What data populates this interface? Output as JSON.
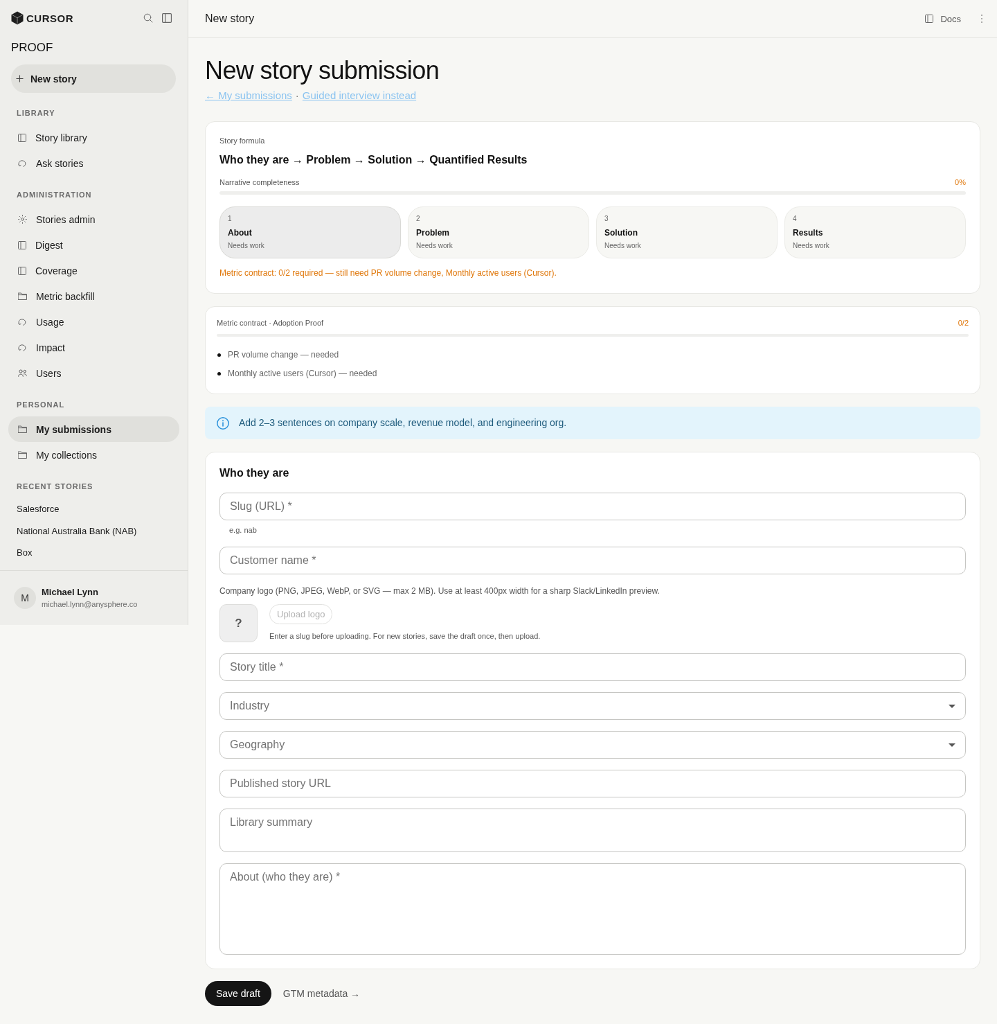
{
  "sidebar": {
    "brand": "CURSOR",
    "product": "PROOF",
    "new_button": {
      "label": "New story"
    },
    "sections": [
      {
        "title": "LIBRARY",
        "items": [
          {
            "label": "Story library",
            "kind": "panel",
            "selected": false
          },
          {
            "label": "Ask stories",
            "kind": "loop",
            "selected": false
          }
        ]
      },
      {
        "title": "ADMINISTRATION",
        "items": [
          {
            "label": "Stories admin",
            "kind": "sun",
            "selected": false
          },
          {
            "label": "Digest",
            "kind": "panel",
            "selected": false
          },
          {
            "label": "Coverage",
            "kind": "panel",
            "selected": false
          },
          {
            "label": "Metric backfill",
            "kind": "folder",
            "selected": false
          },
          {
            "label": "Usage",
            "kind": "loop",
            "selected": false
          },
          {
            "label": "Impact",
            "kind": "loop",
            "selected": false
          },
          {
            "label": "Users",
            "kind": "people",
            "selected": false
          }
        ]
      },
      {
        "title": "PERSONAL",
        "items": [
          {
            "label": "My submissions",
            "kind": "folder",
            "selected": true
          },
          {
            "label": "My collections",
            "kind": "folder",
            "selected": false
          }
        ]
      }
    ],
    "recent": {
      "title": "RECENT STORIES",
      "items": [
        "Salesforce",
        "National Australia Bank (NAB)",
        "Box"
      ]
    },
    "user": {
      "initial": "M",
      "name": "Michael Lynn",
      "email": "michael.lynn@anysphere.co"
    }
  },
  "header": {
    "title": "New story",
    "docs": "Docs"
  },
  "page": {
    "title": "New story submission",
    "links": [
      "← My submissions",
      "Guided interview instead"
    ],
    "separator": "·"
  },
  "formula": {
    "label": "Story formula",
    "title": "Who they are → Problem → Solution → Quantified Results",
    "progress": {
      "label": "Narrative completeness",
      "reading": "0%",
      "level": 0
    },
    "steps": [
      {
        "number": "1",
        "title": "About",
        "status": "Needs work",
        "selected": true
      },
      {
        "number": "2",
        "title": "Problem",
        "status": "Needs work",
        "selected": false
      },
      {
        "number": "3",
        "title": "Solution",
        "status": "Needs work",
        "selected": false
      },
      {
        "number": "4",
        "title": "Results",
        "status": "Needs work",
        "selected": false
      }
    ],
    "warning": "Metric contract: 0/2 required — still need PR volume change, Monthly active users (Cursor)."
  },
  "metric_contract": {
    "title": "Metric contract · Adoption Proof",
    "reading": "0/2",
    "level": 0,
    "items": [
      "PR volume change — needed",
      "Monthly active users (Cursor) — needed"
    ]
  },
  "info": {
    "text": "Add 2–3 sentences on company scale, revenue model, and engineering org."
  },
  "form": {
    "title": "Who they are",
    "fields": [
      {
        "kind": "text",
        "placeholder": "Slug (URL) *",
        "helper": "e.g. nab"
      },
      {
        "kind": "text",
        "placeholder": "Customer name *"
      },
      {
        "kind": "logo",
        "label": "Company logo (PNG, JPEG, WebP, or SVG — max 2 MB). Use at least 400px width for a sharp Slack/LinkedIn preview.",
        "glyph": "?",
        "button": "Upload logo",
        "disabled": true,
        "hint": "Enter a slug before uploading. For new stories, save the draft once, then upload."
      },
      {
        "kind": "text",
        "placeholder": "Story title *"
      },
      {
        "kind": "select",
        "label": "Industry"
      },
      {
        "kind": "select",
        "label": "Geography"
      },
      {
        "kind": "text",
        "placeholder": "Published story URL"
      },
      {
        "kind": "textarea",
        "placeholder": "Library summary"
      },
      {
        "kind": "long-textarea",
        "placeholder": "About (who they are) *"
      }
    ]
  },
  "actions": {
    "primary": "Save draft",
    "secondary": "GTM metadata →"
  }
}
